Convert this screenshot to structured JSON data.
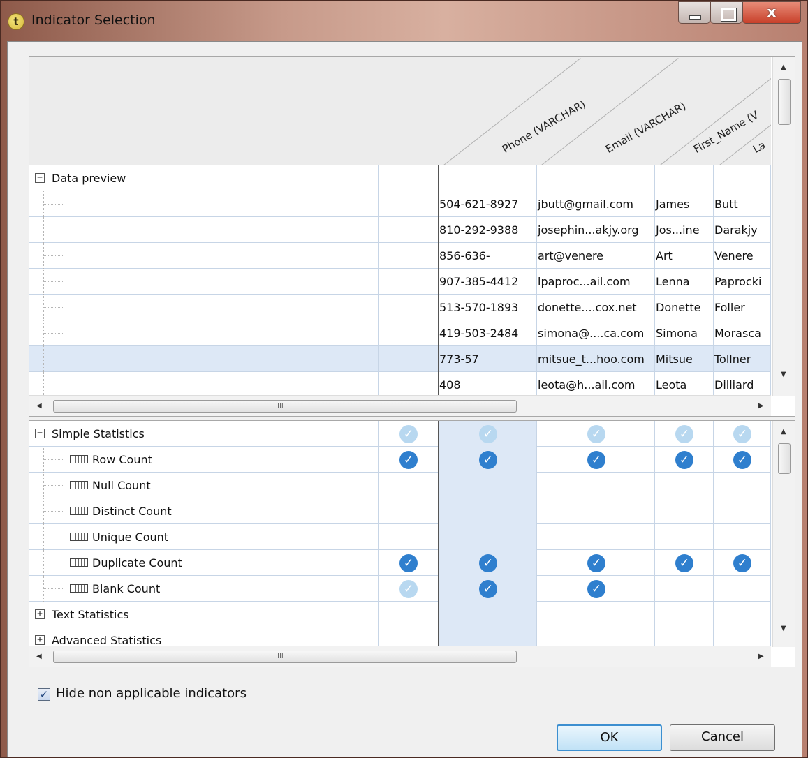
{
  "window": {
    "title": "Indicator Selection",
    "icon": "talend-t-icon",
    "controls": {
      "close": "x"
    }
  },
  "columns": [
    "Phone (VARCHAR)",
    "Email (VARCHAR)",
    "First_Name (V",
    "La"
  ],
  "data_preview": {
    "label": "Data preview",
    "expander": "−",
    "rows": [
      [
        "504-621-8927",
        "jbutt@gmail.com",
        "James",
        "Butt"
      ],
      [
        "810-292-9388",
        "josephin...akjy.org",
        "Jos...ine",
        "Darakjy"
      ],
      [
        "856-636-",
        "art@venere",
        "Art",
        "Venere"
      ],
      [
        "907-385-4412",
        "lpaproc...ail.com",
        "Lenna",
        "Paprocki"
      ],
      [
        "513-570-1893",
        "donette....cox.net",
        "Donette",
        "Foller"
      ],
      [
        "419-503-2484",
        "simona@....ca.com",
        "Simona",
        "Morasca"
      ],
      [
        "773-57",
        "mitsue_t...hoo.com",
        "Mitsue",
        "Tollner"
      ],
      [
        "408",
        "leota@h...ail.com",
        "Leota",
        "Dilliard"
      ]
    ]
  },
  "indicators": {
    "simple_group_label": "Simple Statistics",
    "simple_expander": "−",
    "text_group_label": "Text Statistics",
    "advanced_group_label": "Advanced Statistics",
    "collapsed_expander": "+",
    "check_glyph": "✓",
    "group_checks": [
      "faint",
      "faint",
      "faint",
      "faint",
      "faint"
    ],
    "items": [
      {
        "label": "Row Count",
        "checks": [
          "on",
          "on",
          "on",
          "on",
          "on"
        ]
      },
      {
        "label": "Null Count",
        "checks": [
          "",
          "",
          "",
          "",
          ""
        ]
      },
      {
        "label": "Distinct Count",
        "checks": [
          "",
          "",
          "",
          "",
          ""
        ]
      },
      {
        "label": "Unique Count",
        "checks": [
          "",
          "",
          "",
          "",
          ""
        ]
      },
      {
        "label": "Duplicate Count",
        "checks": [
          "on",
          "on",
          "on",
          "on",
          "on"
        ]
      },
      {
        "label": "Blank Count",
        "checks": [
          "faint",
          "on",
          "on",
          "",
          ""
        ]
      }
    ]
  },
  "scroll": {
    "h_thumb_glyph": "III"
  },
  "options": {
    "hide_non_applicable_label": "Hide non applicable indicators",
    "hide_non_applicable_checked": true,
    "checked_glyph": "✓"
  },
  "buttons": {
    "ok": "OK",
    "cancel": "Cancel"
  }
}
